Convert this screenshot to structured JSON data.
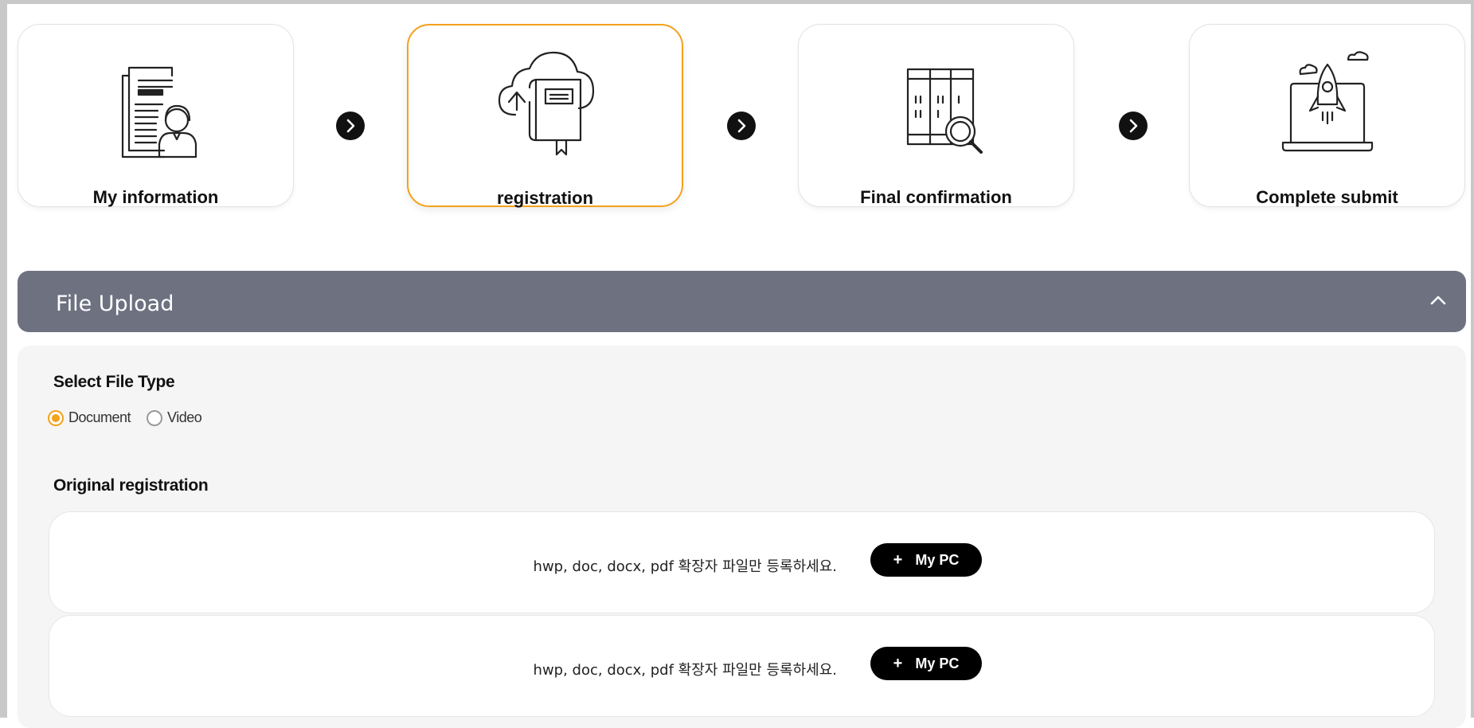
{
  "steps": [
    {
      "label": "My information",
      "icon": "profile-document-icon",
      "active": false
    },
    {
      "label": "registration",
      "icon": "cloud-book-upload-icon",
      "active": true
    },
    {
      "label": "Final confirmation",
      "icon": "binders-magnifier-icon",
      "active": false
    },
    {
      "label": "Complete submit",
      "icon": "laptop-rocket-icon",
      "active": false
    }
  ],
  "panel": {
    "title": "File Upload",
    "collapse_icon": "chevron-up-icon"
  },
  "file_type": {
    "title": "Select File Type",
    "options": [
      {
        "label": "Document",
        "checked": true
      },
      {
        "label": "Video",
        "checked": false
      }
    ]
  },
  "original": {
    "title": "Original registration",
    "rows": [
      {
        "hint": "hwp, doc, docx, pdf 확장자 파일만 등록하세요.",
        "button": "My PC",
        "button_icon": "plus-icon"
      },
      {
        "hint": "hwp, doc, docx, pdf 확장자 파일만 등록하세요.",
        "button": "My PC",
        "button_icon": "plus-icon"
      }
    ]
  },
  "colors": {
    "accent": "#f4a21a",
    "header_bg": "#6e7180",
    "body_bg": "#f5f5f5",
    "button_bg": "#000000"
  }
}
